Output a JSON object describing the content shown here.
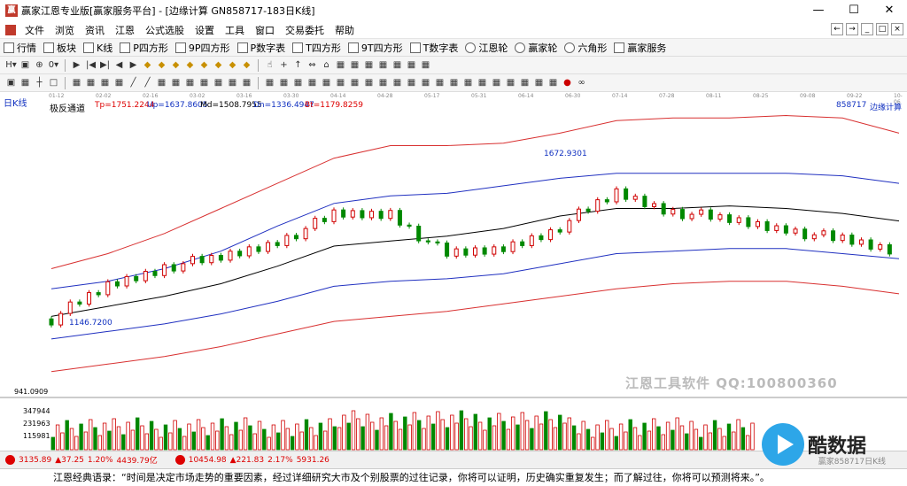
{
  "window": {
    "app_icon": "赢",
    "title": "赢家江恩专业版[赢家服务平台] - [边缘计算  GN858717-183日K线]",
    "controls": [
      "—",
      "☐",
      "✕"
    ]
  },
  "menu": {
    "items": [
      "文件",
      "浏览",
      "资讯",
      "江恩",
      "公式选股",
      "设置",
      "工具",
      "窗口",
      "交易委托",
      "帮助"
    ],
    "right_icons": [
      "←",
      "→",
      "_",
      "□",
      "×"
    ]
  },
  "toolbar1": {
    "items": [
      "行情",
      "板块",
      "K线",
      "P四方形",
      "9P四方形",
      "P数字表",
      "T四方形",
      "9T四方形",
      "T数字表",
      "江恩轮",
      "赢家轮",
      "六角形",
      "赢家服务"
    ]
  },
  "toolbar2": {
    "icons": [
      "H▾",
      "▣",
      "⊕",
      "0▾",
      "▶",
      "|◀",
      "▶|",
      "◀",
      "▶",
      "◆",
      "◆",
      "◆",
      "◆",
      "◆",
      "◆",
      "◆",
      "◆",
      "☝",
      "+",
      "↑",
      "⇔",
      "⌂",
      "▦",
      "▦",
      "▦",
      "▦",
      "▦",
      "▦",
      "▦"
    ]
  },
  "toolbar3": {
    "icons": [
      "▣",
      "▦",
      "┼",
      "□",
      "▦",
      "▦",
      "▦",
      "▦",
      "╱",
      "╱",
      "▦",
      "▦",
      "▦",
      "▦",
      "▦",
      "▦",
      "▦",
      "▦",
      "▦",
      "▦",
      "▦",
      "▦",
      "▦",
      "▦",
      "▦",
      "▦",
      "▦",
      "▦",
      "▦",
      "▦",
      "▦",
      "▦",
      "▦",
      "▦",
      "▦",
      "▦",
      "▦",
      "▦",
      "●",
      "∞"
    ]
  },
  "date_axis": [
    "01-12",
    "02-02",
    "02-16",
    "03-02",
    "03-16",
    "03-30",
    "04-14",
    "04-28",
    "05-17",
    "05-31",
    "06-14",
    "06-30",
    "07-14",
    "07-28",
    "08-11",
    "08-25",
    "09-08",
    "09-22",
    "10-06"
  ],
  "chart_header": {
    "period": "日K线",
    "indicator": "极反通道",
    "tp": "Tp=1751.2244",
    "up": "Up=1637.8605",
    "md": "Md=1508.7955",
    "dn": "Dn=1336.4947",
    "bt": "Bt=1179.8259",
    "code": "858717",
    "name": "边缘计算"
  },
  "annotations": {
    "high": "1672.9301",
    "low": "1146.7200"
  },
  "volume_axis": [
    "941.0909",
    "347944",
    "231963",
    "115981"
  ],
  "watermark": "江恩工具软件  QQ:100800360",
  "bottom_bar": {
    "idx1_value": "3135.89",
    "idx1_change": "▲37.25",
    "idx1_pct": "1.20%",
    "idx1_amount": "4439.79亿",
    "idx2_value": "10454.98",
    "idx2_change": "▲221.83",
    "idx2_pct": "2.17%",
    "idx2_amount": "5931.26",
    "right_text": "赢家858717日K线"
  },
  "quote": "江恩经典语录：“时间是决定市场走势的重要因素，经过详细研究大市及个别股票的过往记录，你将可以证明，历史确实重复发生；而了解过往，你将可以预测将来。”。",
  "brand": {
    "text": "酷数据"
  },
  "colors": {
    "up": "#d00000",
    "down": "#008800",
    "upper_band": "#d83030",
    "mid_band": "#2030c0",
    "middle": "#000000"
  },
  "chart_data": {
    "type": "candlestick",
    "x": [
      "01-12",
      "02-02",
      "02-16",
      "03-02",
      "03-16",
      "03-30",
      "04-14",
      "04-28",
      "05-17",
      "05-31",
      "06-14",
      "06-30",
      "07-14",
      "07-28",
      "08-11",
      "08-25"
    ],
    "close": [
      1160,
      1290,
      1370,
      1400,
      1470,
      1570,
      1580,
      1410,
      1440,
      1530,
      1660,
      1590,
      1550,
      1520,
      1470,
      1430
    ],
    "series": [
      {
        "name": "Tp",
        "values": [
          1360,
          1420,
          1500,
          1600,
          1700,
          1800,
          1850,
          1850,
          1860,
          1900,
          1950,
          1960,
          1960,
          1970,
          1960,
          1900
        ]
      },
      {
        "name": "Up",
        "values": [
          1280,
          1310,
          1360,
          1430,
          1530,
          1620,
          1650,
          1660,
          1690,
          1720,
          1740,
          1740,
          1740,
          1740,
          1730,
          1700
        ]
      },
      {
        "name": "Md",
        "values": [
          1170,
          1210,
          1250,
          1300,
          1370,
          1450,
          1470,
          1490,
          1520,
          1570,
          1600,
          1600,
          1610,
          1600,
          1580,
          1550
        ]
      },
      {
        "name": "Dn",
        "values": [
          1080,
          1110,
          1140,
          1180,
          1230,
          1290,
          1310,
          1320,
          1340,
          1380,
          1420,
          1430,
          1440,
          1440,
          1420,
          1400
        ]
      },
      {
        "name": "Bt",
        "values": [
          950,
          980,
          1010,
          1050,
          1100,
          1150,
          1170,
          1190,
          1220,
          1250,
          1280,
          1300,
          1310,
          1310,
          1290,
          1260
        ]
      }
    ],
    "volume_axis_max": 941.0909
  }
}
